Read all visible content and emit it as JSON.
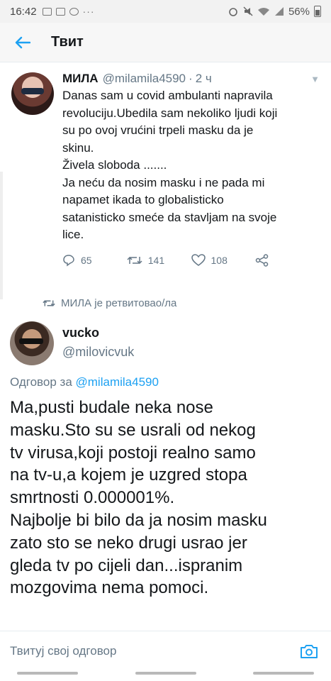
{
  "status_bar": {
    "time": "16:42",
    "battery": "56%",
    "icons_left": [
      "message-icon",
      "image-icon",
      "facebook-icon",
      "more-dots"
    ],
    "icons_right": [
      "alarm-icon",
      "mute-icon",
      "wifi-icon",
      "signal-icon",
      "battery-icon"
    ]
  },
  "header": {
    "title": "Твит",
    "back_icon": "arrow-left-icon",
    "accent": "#1da1f2"
  },
  "tweet": {
    "name": "МИЛА",
    "handle": "@milamila4590",
    "separator": "·",
    "time": "2 ч",
    "text_lines": [
      "Danas sam u covid ambulanti napravila",
      "revoluciju.Ubedila sam nekoliko ljudi koji",
      "su po ovoj vrućini trpeli masku da je",
      "skinu.",
      "Živela sloboda .......",
      "Ja neću da nosim masku i ne pada mi",
      "napamet ikada to globalisticko",
      "satanisticko smeće da stavljam na svoje",
      "lice."
    ],
    "replies": "65",
    "retweets": "141",
    "likes": "108"
  },
  "retweet_notice": "МИЛА је ретвитовао/ла",
  "reply": {
    "name": "vucko",
    "handle": "@milovicvuk",
    "reply_to_prefix": "Одговор за",
    "reply_to_handle": "@milamila4590",
    "text_lines": [
      "Ma,pusti budale neka nose",
      "masku.Sto su se usrali od nekog",
      "tv virusa,koji postoji realno samo",
      "na tv-u,a kojem je uzgred stopa",
      "smrtnosti 0.000001%.",
      "Najbolje bi bilo da ja nosim masku",
      "zato sto se neko drugi usrao jer",
      "gleda tv po cijeli dan...ispranim",
      "mozgovima nema pomoci."
    ]
  },
  "composer": {
    "placeholder": "Твитуј свој одговор",
    "camera_icon": "camera-icon"
  }
}
